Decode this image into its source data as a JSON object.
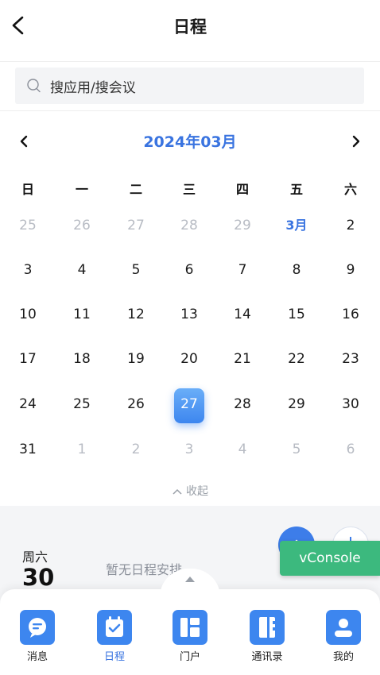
{
  "header": {
    "title": "日程"
  },
  "search": {
    "placeholder": "搜应用/搜会议"
  },
  "calendar": {
    "month_label": "2024年03月",
    "weekdays": [
      "日",
      "一",
      "二",
      "三",
      "四",
      "五",
      "六"
    ],
    "weeks": [
      [
        "25",
        "26",
        "27",
        "28",
        "29",
        "3月",
        "2"
      ],
      [
        "3",
        "4",
        "5",
        "6",
        "7",
        "8",
        "9"
      ],
      [
        "10",
        "11",
        "12",
        "13",
        "14",
        "15",
        "16"
      ],
      [
        "17",
        "18",
        "19",
        "20",
        "21",
        "22",
        "23"
      ],
      [
        "24",
        "25",
        "26",
        "27",
        "28",
        "29",
        "30"
      ],
      [
        "31",
        "1",
        "2",
        "3",
        "4",
        "5",
        "6"
      ]
    ],
    "selected_date": "27",
    "collapse_label": "收起"
  },
  "schedule": {
    "weekday": "周六",
    "day": "30",
    "empty_text": "暂无日程安排"
  },
  "vconsole": {
    "label": "vConsole"
  },
  "tabs": [
    {
      "label": "消息",
      "icon": "message-icon",
      "active": false
    },
    {
      "label": "日程",
      "icon": "calendar-icon",
      "active": true
    },
    {
      "label": "门户",
      "icon": "portal-icon",
      "active": false
    },
    {
      "label": "通讯录",
      "icon": "contacts-icon",
      "active": false
    },
    {
      "label": "我的",
      "icon": "user-icon",
      "active": false
    }
  ],
  "colors": {
    "accent": "#3a74e0",
    "tab_icon": "#3d86ef",
    "vconsole": "#3cb97e",
    "muted": "#b8bcc4"
  }
}
